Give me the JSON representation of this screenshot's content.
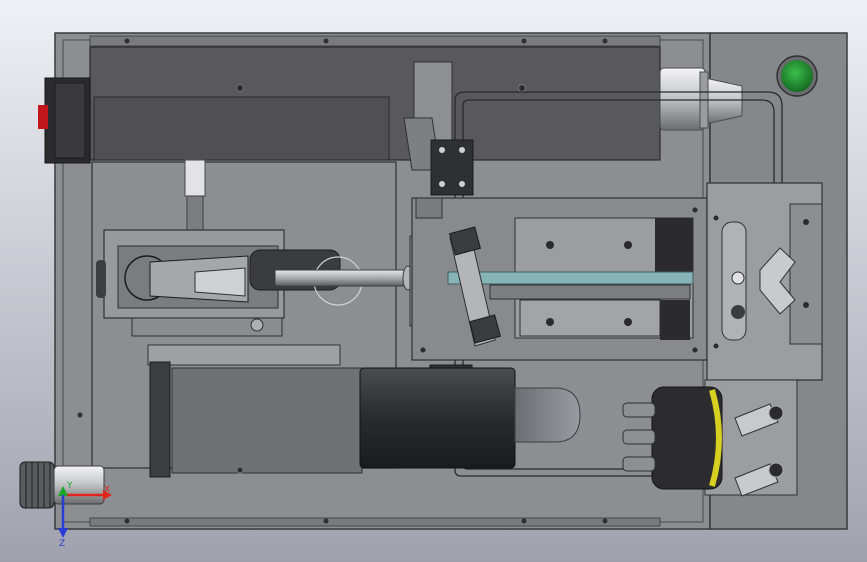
{
  "scene": {
    "background_top": "#f0f1f6",
    "background_bottom": "#9fa1ad",
    "housing_color": "#8f9093",
    "panel_color": "#555659",
    "rail_color": "#a4a5a8",
    "dark_part_color": "#303033",
    "indicator_color": "#1f8f2e",
    "switch_color": "#c0161b",
    "highlight_color": "#d8d020"
  },
  "triad": {
    "x_label": "X",
    "y_label": "Y",
    "z_label": "Z",
    "x_color": "#e0241c",
    "y_color": "#1fa52a",
    "z_color": "#2a3cd8"
  }
}
